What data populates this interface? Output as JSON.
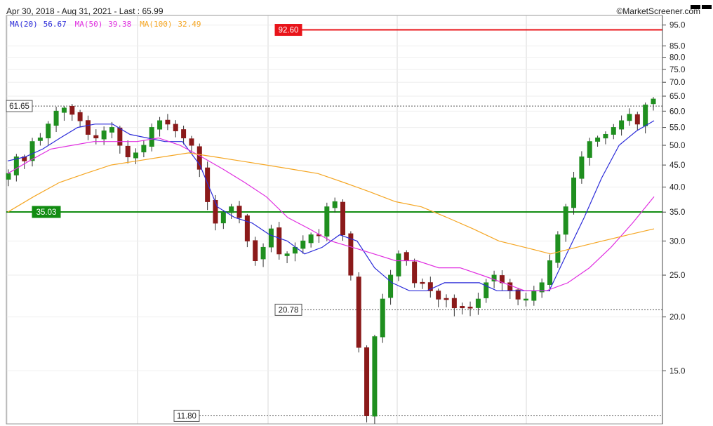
{
  "header": {
    "range_text": "Apr 30, 2018 - Aug 31, 2021 - Last : 65.99",
    "copyright": "©MarketScreener.com"
  },
  "legend": [
    {
      "label": "MA(20)",
      "value": "56.67",
      "color": "#2b2bd9"
    },
    {
      "label": "MA(50)",
      "value": "39.38",
      "color": "#e02ee0"
    },
    {
      "label": "MA(100)",
      "value": "32.49",
      "color": "#f5a623"
    }
  ],
  "colors": {
    "up": "#1f8f1f",
    "down": "#8b1a1a",
    "resistance": "#e8141a",
    "support": "#118c11",
    "grid": "#d9d9d9"
  },
  "chart_data": {
    "type": "line",
    "title": "",
    "period": "Apr 30, 2018 - Aug 31, 2021",
    "last": 65.99,
    "y_scale": "log",
    "ylim": [
      11.3,
      100
    ],
    "yticks": [
      15.0,
      20.0,
      25.0,
      30.0,
      35.0,
      40.0,
      45.0,
      50.0,
      55.0,
      60.0,
      65.0,
      70.0,
      75.0,
      80.0,
      85.0,
      95.0
    ],
    "levels": [
      {
        "label": "92.60",
        "value": 92.6,
        "kind": "resistance"
      },
      {
        "label": "35.03",
        "value": 35.03,
        "kind": "support"
      },
      {
        "label": "61.65",
        "value": 61.65,
        "kind": "high"
      },
      {
        "label": "20.78",
        "value": 20.78,
        "kind": "marker"
      },
      {
        "label": "11.80",
        "value": 11.8,
        "kind": "low"
      }
    ],
    "price": [
      43,
      47,
      46,
      51,
      52,
      56,
      60,
      61,
      59,
      57,
      53,
      52,
      54,
      55,
      50,
      47,
      48,
      50,
      55,
      57,
      56,
      54,
      52,
      50,
      44,
      37,
      33,
      35,
      36,
      34,
      30,
      27,
      29,
      32,
      28,
      28,
      29,
      30,
      31,
      31,
      36,
      37,
      31,
      25,
      17,
      11.8,
      18,
      22,
      25,
      28,
      27,
      24,
      24,
      23,
      22,
      22,
      21,
      21,
      21,
      22,
      24,
      25,
      24,
      23,
      22,
      22,
      23,
      24,
      27,
      31,
      36,
      42,
      47,
      51,
      52,
      53,
      55,
      57,
      59,
      56,
      62,
      64
    ],
    "series": [
      {
        "name": "MA(20)",
        "values": [
          46,
          47,
          49,
          52,
          55,
          56,
          56,
          53,
          52,
          51,
          51,
          45,
          36,
          34,
          33,
          31,
          30,
          28,
          29,
          31,
          30,
          26,
          24,
          23,
          23,
          24,
          24,
          24,
          23,
          23,
          23,
          23,
          28,
          34,
          42,
          50,
          54,
          57
        ]
      },
      {
        "name": "MA(50)",
        "values": [
          43,
          46,
          49,
          50,
          51,
          51,
          51,
          52,
          50,
          47,
          44,
          41,
          38,
          34,
          32,
          30,
          29,
          28,
          27,
          27,
          26,
          26,
          25,
          24,
          23,
          23,
          24,
          26,
          29,
          33,
          38
        ]
      },
      {
        "name": "MA(100)",
        "values": [
          35,
          38,
          41,
          43,
          45,
          46,
          47,
          48,
          47,
          46,
          45,
          44,
          43,
          41,
          39,
          37,
          36,
          34,
          32,
          30,
          29,
          28,
          29,
          30,
          31,
          32
        ]
      }
    ]
  }
}
